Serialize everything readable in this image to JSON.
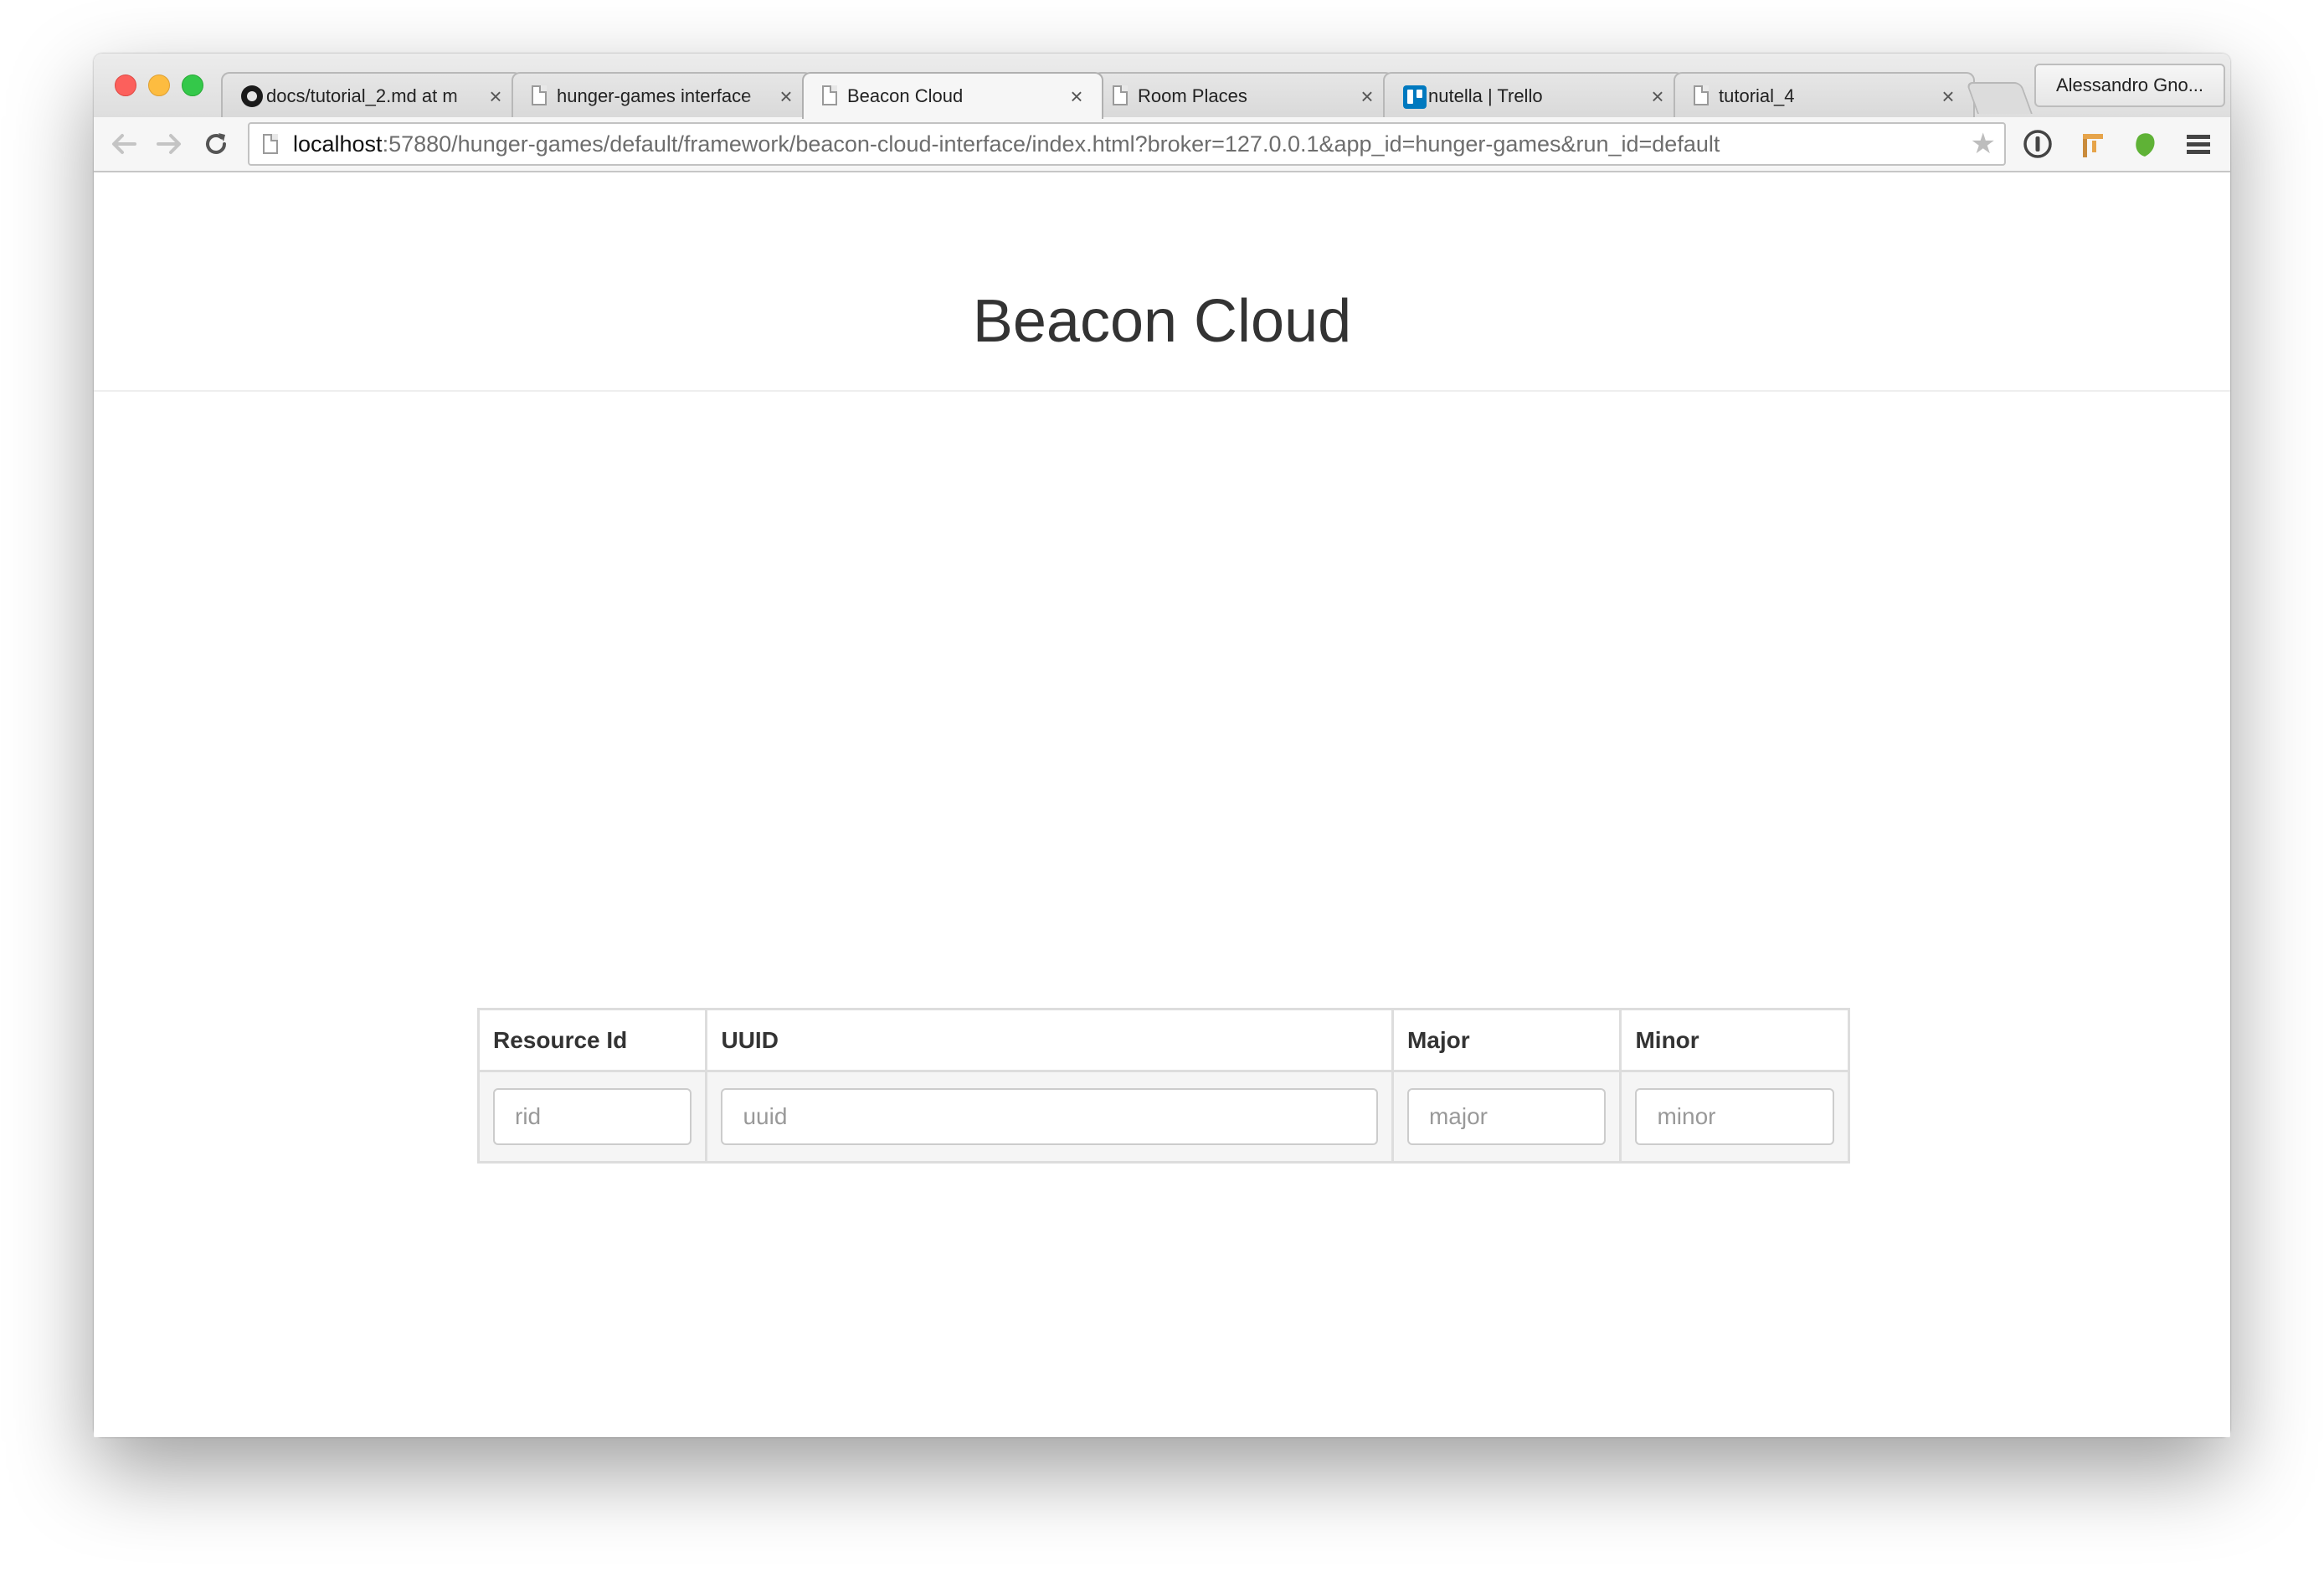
{
  "browser": {
    "tabs": [
      {
        "icon": "github-icon",
        "title": "docs/tutorial_2.md at m",
        "active": false
      },
      {
        "icon": "page-icon",
        "title": "hunger-games interface",
        "active": false
      },
      {
        "icon": "page-icon",
        "title": "Beacon Cloud",
        "active": true
      },
      {
        "icon": "page-icon",
        "title": "Room Places",
        "active": false
      },
      {
        "icon": "trello-icon",
        "title": "nutella | Trello",
        "active": false
      },
      {
        "icon": "page-icon",
        "title": "tutorial_4",
        "active": false
      }
    ],
    "close_glyph": "×",
    "profile_name": "Alessandro Gno...",
    "url_host": "localhost",
    "url_rest": ":57880/hunger-games/default/framework/beacon-cloud-interface/index.html?broker=127.0.0.1&app_id=hunger-games&run_id=default"
  },
  "page": {
    "title": "Beacon Cloud",
    "table": {
      "headers": [
        "Resource Id",
        "UUID",
        "Major",
        "Minor"
      ],
      "placeholders": [
        "rid",
        "uuid",
        "major",
        "minor"
      ]
    }
  },
  "colors": {
    "trello_blue": "#0079bf",
    "evernote_green": "#5fb236"
  }
}
